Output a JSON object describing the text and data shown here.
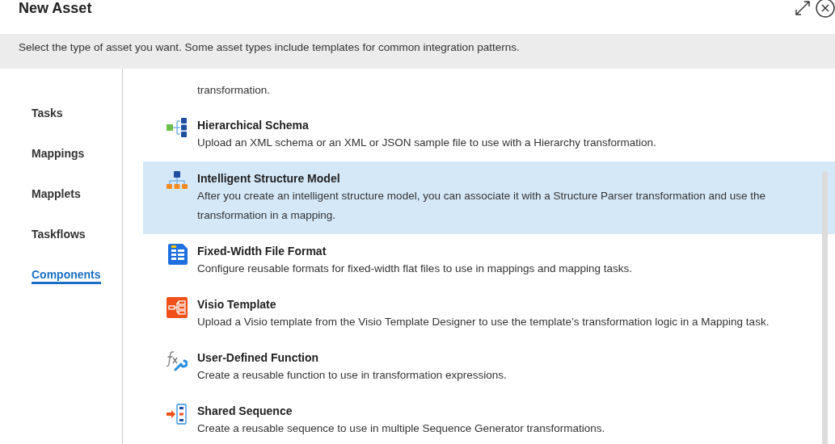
{
  "dialog": {
    "title": "New Asset",
    "intro": "Select the type of asset you want. Some asset types include templates for common integration patterns."
  },
  "nav": [
    {
      "label": "Tasks",
      "selected": false
    },
    {
      "label": "Mappings",
      "selected": false
    },
    {
      "label": "Mapplets",
      "selected": false
    },
    {
      "label": "Taskflows",
      "selected": false
    },
    {
      "label": "Components",
      "selected": true
    }
  ],
  "assets": [
    {
      "kind": "fragment",
      "description": "transformation."
    },
    {
      "kind": "asset",
      "title": "Hierarchical Schema",
      "description": "Upload an XML schema or an XML or JSON sample file to use with a Hierarchy transformation.",
      "selected": false
    },
    {
      "kind": "asset",
      "title": "Intelligent Structure Model",
      "description": "After you create an intelligent structure model, you can associate it with a Structure Parser transformation and use the transformation in a mapping.",
      "selected": true
    },
    {
      "kind": "asset",
      "title": "Fixed-Width File Format",
      "description": "Configure reusable formats for fixed-width flat files to use in mappings and mapping tasks.",
      "selected": false
    },
    {
      "kind": "asset",
      "title": "Visio Template",
      "description": "Upload a Visio template from the Visio Template Designer to use the template’s transformation logic in a Mapping task.",
      "selected": false
    },
    {
      "kind": "asset",
      "title": "User-Defined Function",
      "description": "Create a reusable function to use in transformation expressions.",
      "selected": false
    },
    {
      "kind": "asset",
      "title": "Shared Sequence",
      "description": "Create a reusable sequence to use in multiple Sequence Generator transformations.",
      "selected": false
    }
  ]
}
